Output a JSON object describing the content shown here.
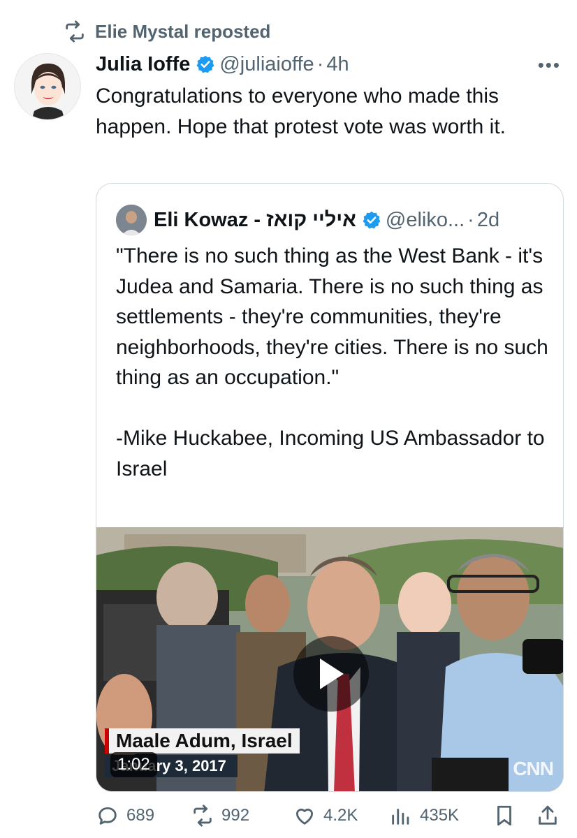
{
  "repost": {
    "label": "Elie Mystal reposted"
  },
  "tweet": {
    "name": "Julia Ioffe",
    "handle": "@juliaioffe",
    "separator": "·",
    "time": "4h",
    "more": "•••",
    "text": "Congratulations to everyone who made this happen. Hope that protest vote was worth it."
  },
  "quote": {
    "name": "Eli Kowaz - איליי קואז",
    "handle": "@eliko...",
    "separator": "·",
    "time": "2d",
    "text": "\"There is no such thing as the West Bank - it's Judea and Samaria. There is no such thing as settlements - they're communities, they're neighborhoods, they're cities. There is no such thing as an occupation.\"\n\n-Mike Huckabee, Incoming US Ambassador to Israel",
    "media": {
      "location": "Maale Adum, Israel",
      "date": "January 3, 2017",
      "duration": "1:02",
      "network": "CNN"
    }
  },
  "actions": {
    "replies": "689",
    "reposts": "992",
    "likes": "4.2K",
    "views": "435K"
  },
  "colors": {
    "accent": "#1d9bf0",
    "muted": "#536471",
    "border": "#cfd9de"
  }
}
